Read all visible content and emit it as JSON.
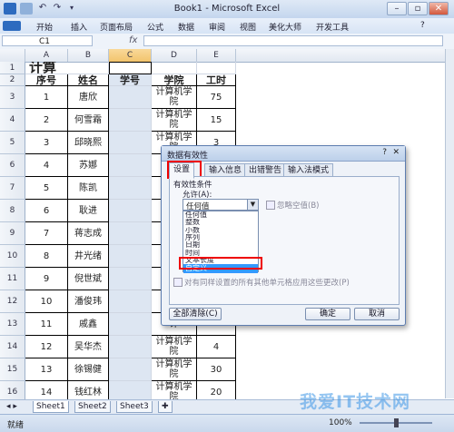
{
  "window": {
    "title": "Book1 - Microsoft Excel"
  },
  "title_controls": {
    "minimize": "–",
    "restore": "▫",
    "close": "✕"
  },
  "ribbon": {
    "tabs": [
      "开始",
      "插入",
      "页面布局",
      "公式",
      "数据",
      "审阅",
      "视图",
      "美化大师",
      "开发工具"
    ],
    "help": "?"
  },
  "formula_bar": {
    "name_box": "C1",
    "fx": "fx",
    "value": ""
  },
  "columns": [
    "A",
    "B",
    "C",
    "D",
    "E"
  ],
  "rows": [
    {
      "num": "1",
      "a": "计算",
      "b": "",
      "c": "",
      "d": "",
      "e": ""
    },
    {
      "num": "2",
      "a": "序号",
      "b": "姓名",
      "c": "学号",
      "d": "学院",
      "e": "工时"
    },
    {
      "num": "3",
      "a": "1",
      "b": "唐欣",
      "c": "",
      "d": "计算机学院",
      "e": "75"
    },
    {
      "num": "4",
      "a": "2",
      "b": "何雪霜",
      "c": "",
      "d": "计算机学院",
      "e": "15"
    },
    {
      "num": "5",
      "a": "3",
      "b": "邱晓熙",
      "c": "",
      "d": "计算机学院",
      "e": "3"
    },
    {
      "num": "6",
      "a": "4",
      "b": "苏娜",
      "c": "",
      "d": "计",
      "e": ""
    },
    {
      "num": "7",
      "a": "5",
      "b": "陈凯",
      "c": "",
      "d": "计",
      "e": ""
    },
    {
      "num": "8",
      "a": "6",
      "b": "耿进",
      "c": "",
      "d": "计",
      "e": ""
    },
    {
      "num": "9",
      "a": "7",
      "b": "蒋志成",
      "c": "",
      "d": "计",
      "e": ""
    },
    {
      "num": "10",
      "a": "8",
      "b": "井光绪",
      "c": "",
      "d": "计",
      "e": ""
    },
    {
      "num": "11",
      "a": "9",
      "b": "倪世斌",
      "c": "",
      "d": "计",
      "e": ""
    },
    {
      "num": "12",
      "a": "10",
      "b": "潘俊玮",
      "c": "",
      "d": "计",
      "e": ""
    },
    {
      "num": "13",
      "a": "11",
      "b": "戚鑫",
      "c": "",
      "d": "计",
      "e": ""
    },
    {
      "num": "14",
      "a": "12",
      "b": "吴华杰",
      "c": "",
      "d": "计算机学院",
      "e": "4"
    },
    {
      "num": "15",
      "a": "13",
      "b": "徐锡健",
      "c": "",
      "d": "计算机学院",
      "e": "30"
    },
    {
      "num": "16",
      "a": "14",
      "b": "钱红林",
      "c": "",
      "d": "计算机学院",
      "e": "20"
    }
  ],
  "sheet_tabs": [
    "Sheet1",
    "Sheet2",
    "Sheet3"
  ],
  "status": {
    "mode": "就绪",
    "zoom": "100%"
  },
  "dialog": {
    "title": "数据有效性",
    "tabs": [
      "设置",
      "输入信息",
      "出错警告",
      "输入法模式"
    ],
    "group_label": "有效性条件",
    "allow_label": "允许(A):",
    "allow_value": "任何值",
    "ignore_blank": "忽略空值(B)",
    "options": [
      "任何值",
      "整数",
      "小数",
      "序列",
      "日期",
      "时间",
      "文本长度",
      "自定义"
    ],
    "selected_option": "自定义",
    "apply_all": "对有同样设置的所有其他单元格应用这些更改(P)",
    "clear_all": "全部清除(C)",
    "ok": "确定",
    "cancel": "取消"
  },
  "watermark": "我爱IT技术网",
  "colors": {
    "accent": "#3a7bd5",
    "highlight_red": "#e00000",
    "selected": "#3399ff"
  }
}
